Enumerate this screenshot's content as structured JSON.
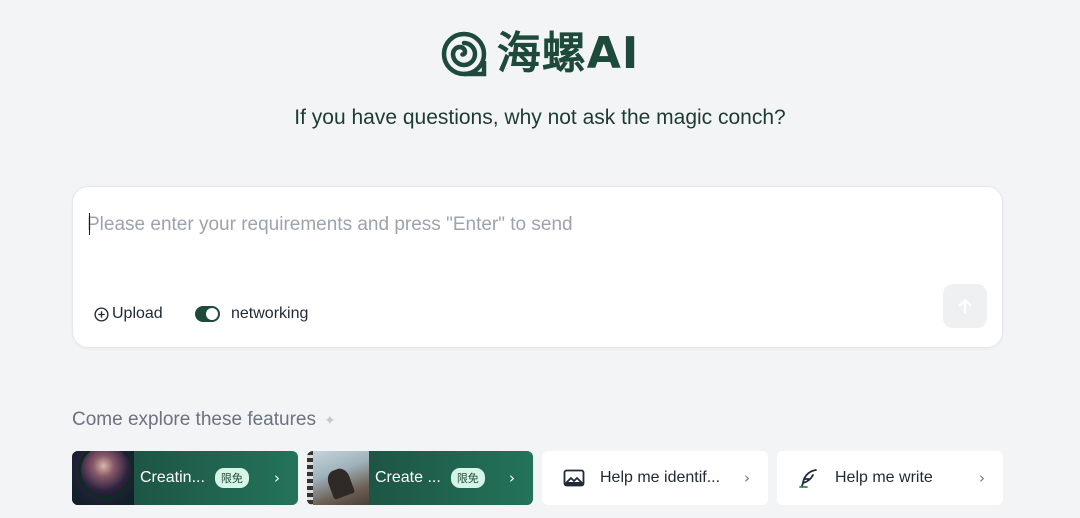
{
  "brand": {
    "name": "海螺AI",
    "icon": "conch-logo-icon"
  },
  "tagline": "If you have questions, why not ask the magic conch?",
  "composer": {
    "placeholder": "Please enter your requirements and press \"Enter\" to send",
    "value": "",
    "upload_label": "Upload",
    "upload_icon": "plus-circle-icon",
    "networking_label": "networking",
    "networking_enabled": true,
    "send_icon": "arrow-up-icon"
  },
  "explore": {
    "heading": "Come explore these features",
    "sparkle": "✦"
  },
  "features": [
    {
      "label": "Creatin...",
      "badge": "限免",
      "chevron": "›",
      "style": "dark",
      "thumbnail": "portrait-thumbnail"
    },
    {
      "label": "Create ...",
      "badge": "限免",
      "chevron": "›",
      "style": "dark",
      "thumbnail": "film-scene-thumbnail"
    },
    {
      "label": "Help me identif...",
      "chevron": "›",
      "style": "light",
      "icon": "image-icon"
    },
    {
      "label": "Help me write",
      "chevron": "›",
      "style": "light",
      "icon": "feather-pen-icon"
    }
  ],
  "colors": {
    "brand": "#1d4a3a",
    "background": "#f3f4f6",
    "badge_bg": "#d7f5e6"
  }
}
